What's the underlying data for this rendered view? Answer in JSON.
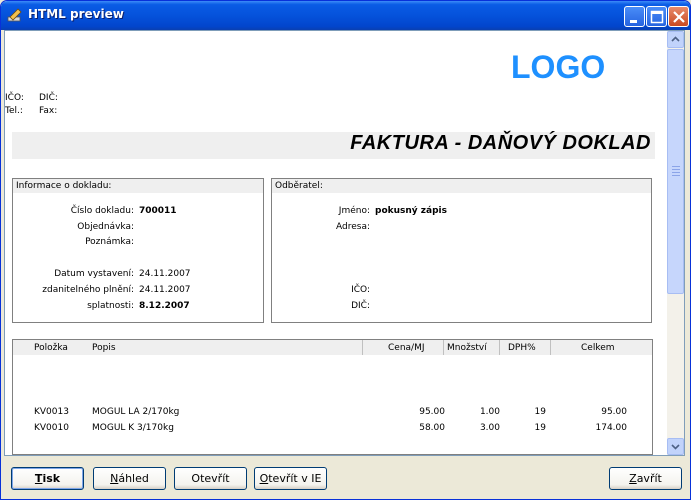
{
  "window": {
    "title": "HTML preview"
  },
  "document": {
    "logo": "LOGO",
    "ico_label": "IČO:",
    "dic_label": "DIČ:",
    "tel_label": "Tel.:",
    "fax_label": "Fax:",
    "title": "FAKTURA - DAŇOVÝ DOKLAD",
    "info": {
      "header": "Informace o dokladu:",
      "cislo_label": "Číslo dokladu:",
      "cislo_value": "700011",
      "objednavka_label": "Objednávka:",
      "poznamka_label": "Poznámka:",
      "vystaveni_label": "Datum vystavení:",
      "vystaveni_value": "24.11.2007",
      "plneni_label": "zdanitelného plnění:",
      "plneni_value": "24.11.2007",
      "splatnost_label": "splatnosti:",
      "splatnost_value": "8.12.2007"
    },
    "customer": {
      "header": "Odběratel:",
      "jmeno_label": "Jméno:",
      "jmeno_value": "pokusný zápis",
      "adresa_label": "Adresa:",
      "ico_label": "IČO:",
      "dic_label": "DIČ:"
    },
    "items": {
      "columns": [
        "Položka",
        "Popis",
        "Cena/MJ",
        "Množství",
        "DPH%",
        "Celkem"
      ],
      "rows": [
        {
          "polozka": "KV0013",
          "popis": "MOGUL LA 2/170kg",
          "cena": "95.00",
          "mnozstvi": "1.00",
          "dph": "19",
          "celkem": "95.00"
        },
        {
          "polozka": "KV0010",
          "popis": "MOGUL K 3/170kg",
          "cena": "58.00",
          "mnozstvi": "3.00",
          "dph": "19",
          "celkem": "174.00"
        }
      ]
    }
  },
  "buttons": {
    "print_u": "T",
    "print_rest": "isk",
    "preview_u": "N",
    "preview_rest": "áhled",
    "open": "Otevřít",
    "open_ie_u": "O",
    "open_ie_rest": "tevřít v IE",
    "close_u": "Z",
    "close_rest": "avřít"
  },
  "icons": {
    "app": "pencil-icon",
    "minimize": "minimize-icon",
    "maximize": "maximize-icon",
    "close": "close-icon",
    "scroll_up": "arrow-up-icon",
    "scroll_down": "arrow-down-icon"
  },
  "colors": {
    "titlebar": "#0552db",
    "logo": "#1e90ff",
    "banner": "#efefef",
    "close_button": "#c94a20"
  }
}
